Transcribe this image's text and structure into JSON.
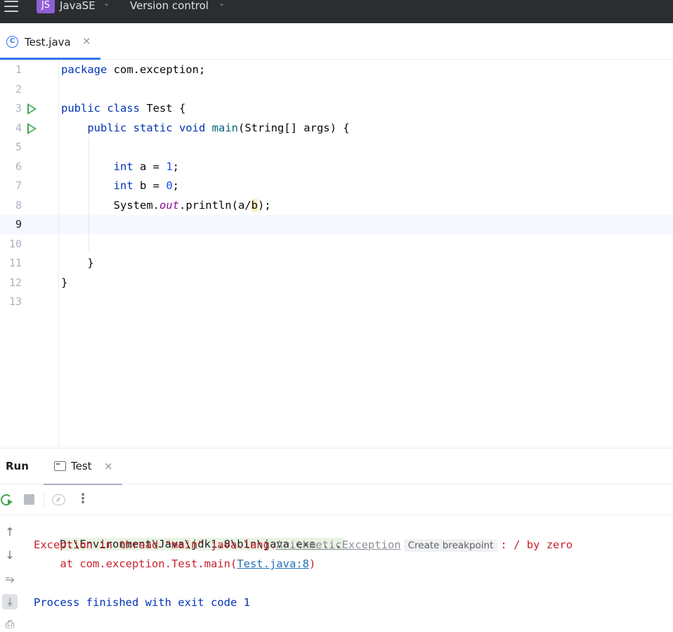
{
  "topbar": {
    "project_badge": "JS",
    "project_name": "JavaSE",
    "vcs_label": "Version control"
  },
  "editor_tab": {
    "icon_letter": "C",
    "file_name": "Test.java",
    "close_glyph": "×"
  },
  "editor": {
    "current_line": 9,
    "lines": [
      {
        "n": "1"
      },
      {
        "n": "2"
      },
      {
        "n": "3"
      },
      {
        "n": "4"
      },
      {
        "n": "5"
      },
      {
        "n": "6"
      },
      {
        "n": "7"
      },
      {
        "n": "8"
      },
      {
        "n": "9"
      },
      {
        "n": "10"
      },
      {
        "n": "11"
      },
      {
        "n": "12"
      },
      {
        "n": "13"
      }
    ],
    "code": {
      "l1_kw": "package",
      "l1_rest": " com.exception;",
      "l3_kw": "public class",
      "l3_rest": " Test {",
      "l4_kw": "public static void",
      "l4_fn": "main",
      "l4_rest": "(String[] args) {",
      "l6_kw": "int",
      "l6_mid": " a = ",
      "l6_num": "1",
      "l6_end": ";",
      "l7_kw": "int",
      "l7_mid": " b = ",
      "l7_num": "0",
      "l7_end": ";",
      "l8_a": "System.",
      "l8_field": "out",
      "l8_b": ".println(a/",
      "l8_hl": "b",
      "l8_c": ");",
      "l11": "}",
      "l12": "}"
    }
  },
  "run_panel": {
    "title": "Run",
    "tab_label": "Test",
    "close_glyph": "×",
    "more_glyph": "⋮"
  },
  "console": {
    "command": "D:\\Environment\\Java\\jdk1.8\\bin\\java.exe ...",
    "exc_prefix": "Exception in thread \"main\" java.lang.",
    "exc_class": "ArithmeticException",
    "create_breakpoint": "Create breakpoint",
    "exc_suffix": ": / by zero",
    "trace_prefix": "    at com.exception.Test.main(",
    "trace_link": "Test.java:8",
    "trace_suffix": ")",
    "finish": "Process finished with exit code 1"
  }
}
